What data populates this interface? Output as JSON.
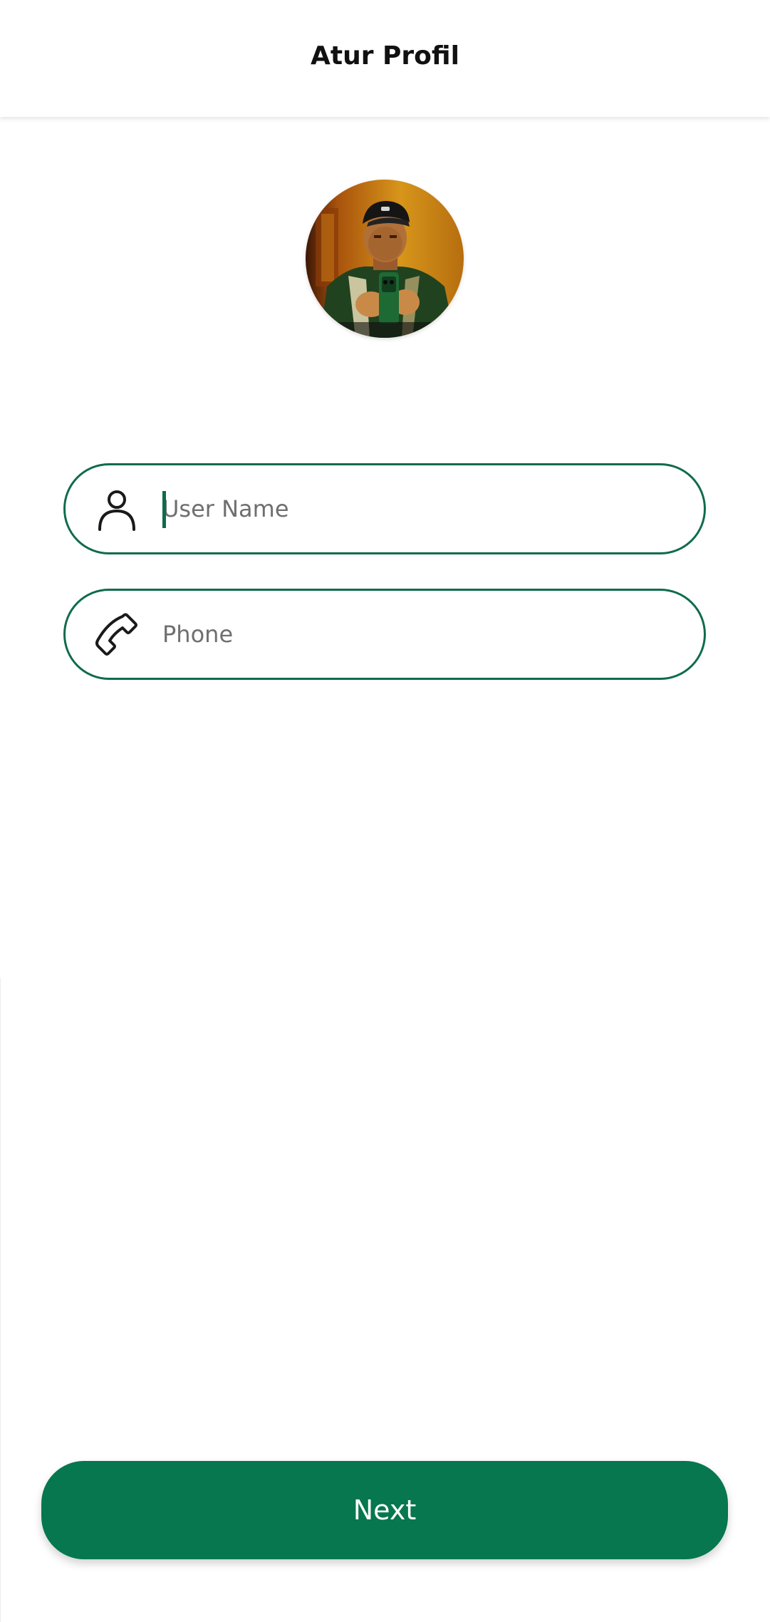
{
  "header": {
    "title": "Atur Profil"
  },
  "avatar": {
    "icon": "profile-photo"
  },
  "form": {
    "username": {
      "placeholder": "User Name",
      "value": "",
      "icon": "user-icon"
    },
    "phone": {
      "placeholder": "Phone",
      "value": "",
      "icon": "phone-icon"
    }
  },
  "actions": {
    "next_label": "Next"
  },
  "colors": {
    "accent": "#06774f",
    "field_border": "#0f6b4e",
    "background": "#ffffff",
    "title": "#111111",
    "placeholder": "#6f6f6f"
  }
}
